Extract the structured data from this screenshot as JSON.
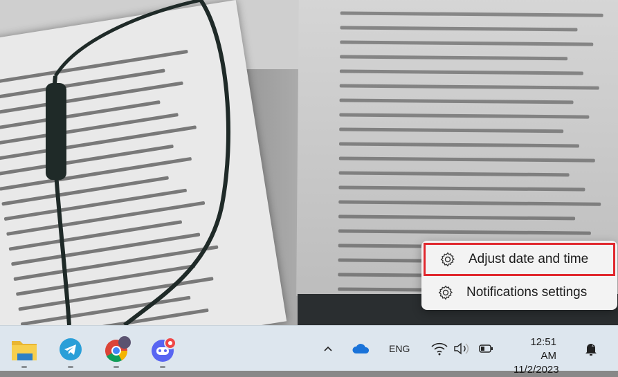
{
  "context_menu": {
    "items": [
      {
        "label": "Adjust date and time",
        "icon": "gear-icon",
        "highlighted": true,
        "highlight_color": "#e0282e"
      },
      {
        "label": "Notifications settings",
        "icon": "gear-icon",
        "highlighted": false
      }
    ]
  },
  "taskbar": {
    "apps": [
      {
        "name": "File Explorer",
        "icon": "folder-icon"
      },
      {
        "name": "Telegram",
        "icon": "telegram-icon"
      },
      {
        "name": "Google Chrome",
        "icon": "chrome-icon"
      },
      {
        "name": "Discord",
        "icon": "discord-icon",
        "badge": true
      }
    ],
    "tray": {
      "language": "ENG",
      "time": "12:51 AM",
      "date": "11/2/2023"
    }
  }
}
